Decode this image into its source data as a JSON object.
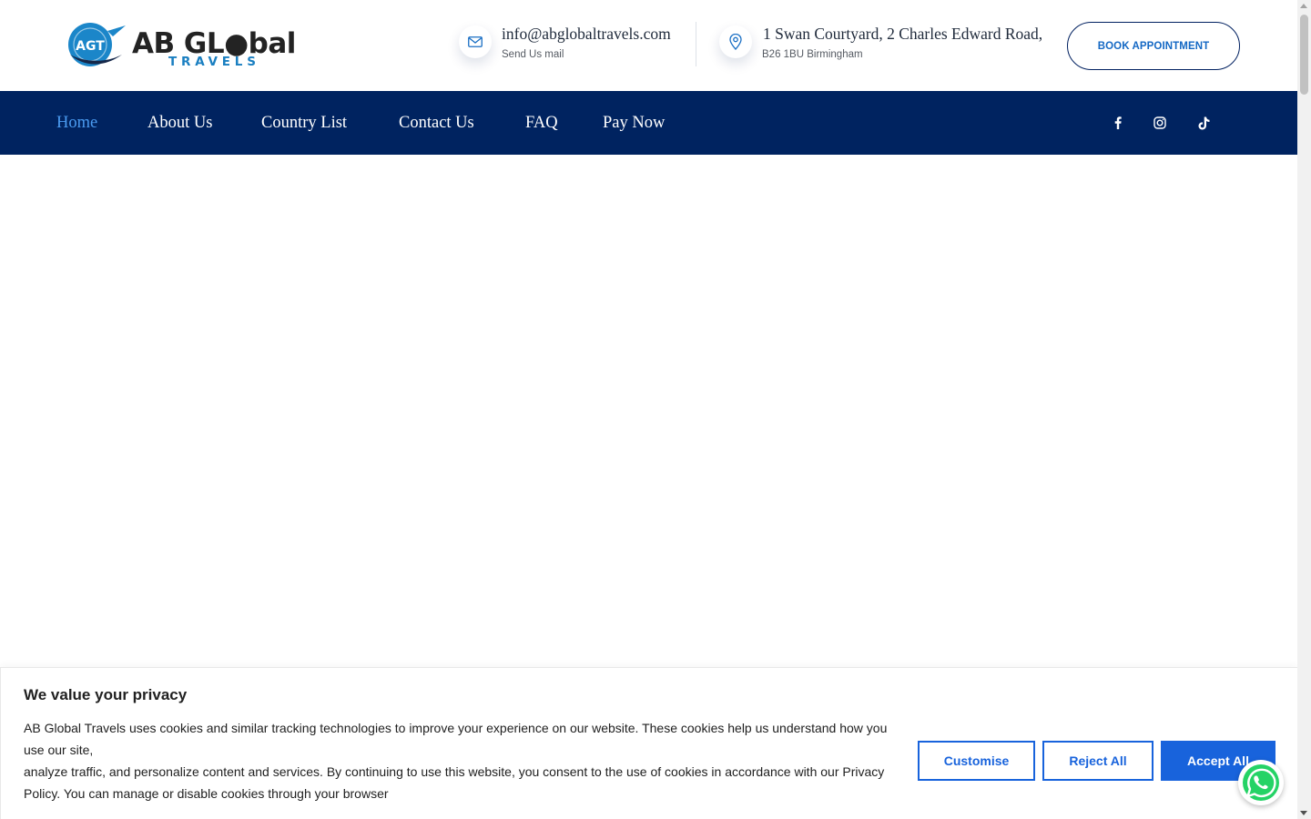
{
  "logo": {
    "monogram": "AGT",
    "main": "AB GL●bal",
    "sub": "TRAVELS"
  },
  "contact": {
    "email": "info@abglobaltravels.com",
    "email_sub": "Send Us mail",
    "address": "1 Swan Courtyard, 2 Charles Edward Road,",
    "address_sub": "B26 1BU Birmingham",
    "email_icon": "envelope-icon",
    "address_icon": "map-pin-icon"
  },
  "header": {
    "book_label": "BOOK APPOINTMENT"
  },
  "nav": {
    "items": [
      {
        "label": "Home",
        "active": true
      },
      {
        "label": "About Us"
      },
      {
        "label": "Country List"
      },
      {
        "label": "Contact Us"
      },
      {
        "label": "FAQ"
      },
      {
        "label": "Pay Now"
      }
    ],
    "social": [
      "facebook-icon",
      "instagram-icon",
      "tiktok-icon"
    ]
  },
  "cookie": {
    "title": "We value your privacy",
    "line1": "AB Global Travels uses cookies and similar tracking technologies to improve your experience on our website. These cookies help us understand how you use our site,",
    "line2": "analyze traffic, and personalize content and services. By continuing to use this website, you consent to the use of cookies in accordance with our Privacy Policy. You can manage or disable cookies through your browser",
    "customise_label": "Customise",
    "reject_label": "Reject All",
    "accept_label": "Accept All"
  },
  "colors": {
    "navy": "#002360",
    "accent_blue": "#1863dc",
    "active_nav": "#4b9cf2",
    "whatsapp_green": "#25d366"
  },
  "whatsapp_icon": "whatsapp-icon"
}
